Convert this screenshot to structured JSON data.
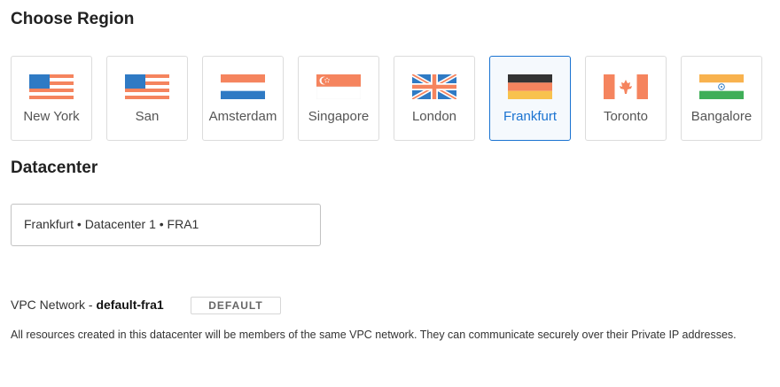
{
  "region_heading": "Choose Region",
  "regions": [
    {
      "label": "New York",
      "flag": "us-flag-icon",
      "selected": false
    },
    {
      "label": "San",
      "flag": "us-flag-icon",
      "selected": false
    },
    {
      "label": "Amsterdam",
      "flag": "netherlands-flag-icon",
      "selected": false
    },
    {
      "label": "Singapore",
      "flag": "singapore-flag-icon",
      "selected": false
    },
    {
      "label": "London",
      "flag": "uk-flag-icon",
      "selected": false
    },
    {
      "label": "Frankfurt",
      "flag": "germany-flag-icon",
      "selected": true
    },
    {
      "label": "Toronto",
      "flag": "canada-flag-icon",
      "selected": false
    },
    {
      "label": "Bangalore",
      "flag": "india-flag-icon",
      "selected": false
    }
  ],
  "datacenter_heading": "Datacenter",
  "datacenter_value": "Frankfurt • Datacenter 1 • FRA1",
  "vpc": {
    "label": "VPC Network - ",
    "name": "default-fra1",
    "badge": "DEFAULT",
    "description": "All resources created in this datacenter will be members of the same VPC network. They can communicate securely over their Private IP addresses."
  },
  "colors": {
    "accent": "#1a73d1",
    "flag_blue": "#2f7ac4",
    "flag_orange": "#f5845e"
  }
}
